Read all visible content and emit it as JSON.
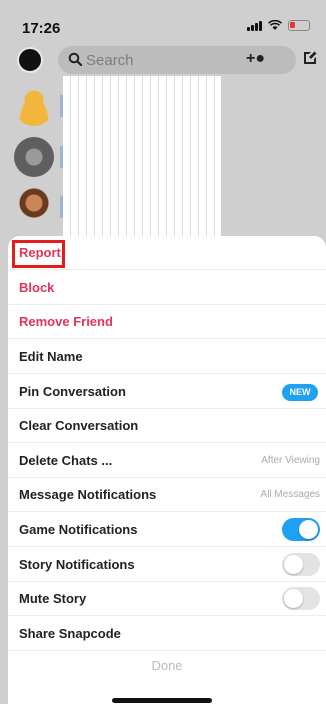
{
  "status_bar": {
    "time": "17:26"
  },
  "header": {
    "search_placeholder": "Search"
  },
  "menu": {
    "items": [
      {
        "label": "Report",
        "style": "red"
      },
      {
        "label": "Block",
        "style": "red"
      },
      {
        "label": "Remove Friend",
        "style": "red"
      },
      {
        "label": "Edit Name"
      },
      {
        "label": "Pin Conversation",
        "badge": "NEW"
      },
      {
        "label": "Clear Conversation"
      },
      {
        "label": "Delete Chats ...",
        "value": "After Viewing"
      },
      {
        "label": "Message Notifications",
        "value": "All Messages"
      },
      {
        "label": "Game Notifications",
        "toggle": "on"
      },
      {
        "label": "Story Notifications",
        "toggle": "off"
      },
      {
        "label": "Mute Story",
        "toggle": "off"
      },
      {
        "label": "Share Snapcode"
      }
    ],
    "done_label": "Done"
  },
  "colors": {
    "accent_red": "#e3345a",
    "toggle_blue": "#1ea1f2",
    "highlight_red": "#e31b1b"
  }
}
